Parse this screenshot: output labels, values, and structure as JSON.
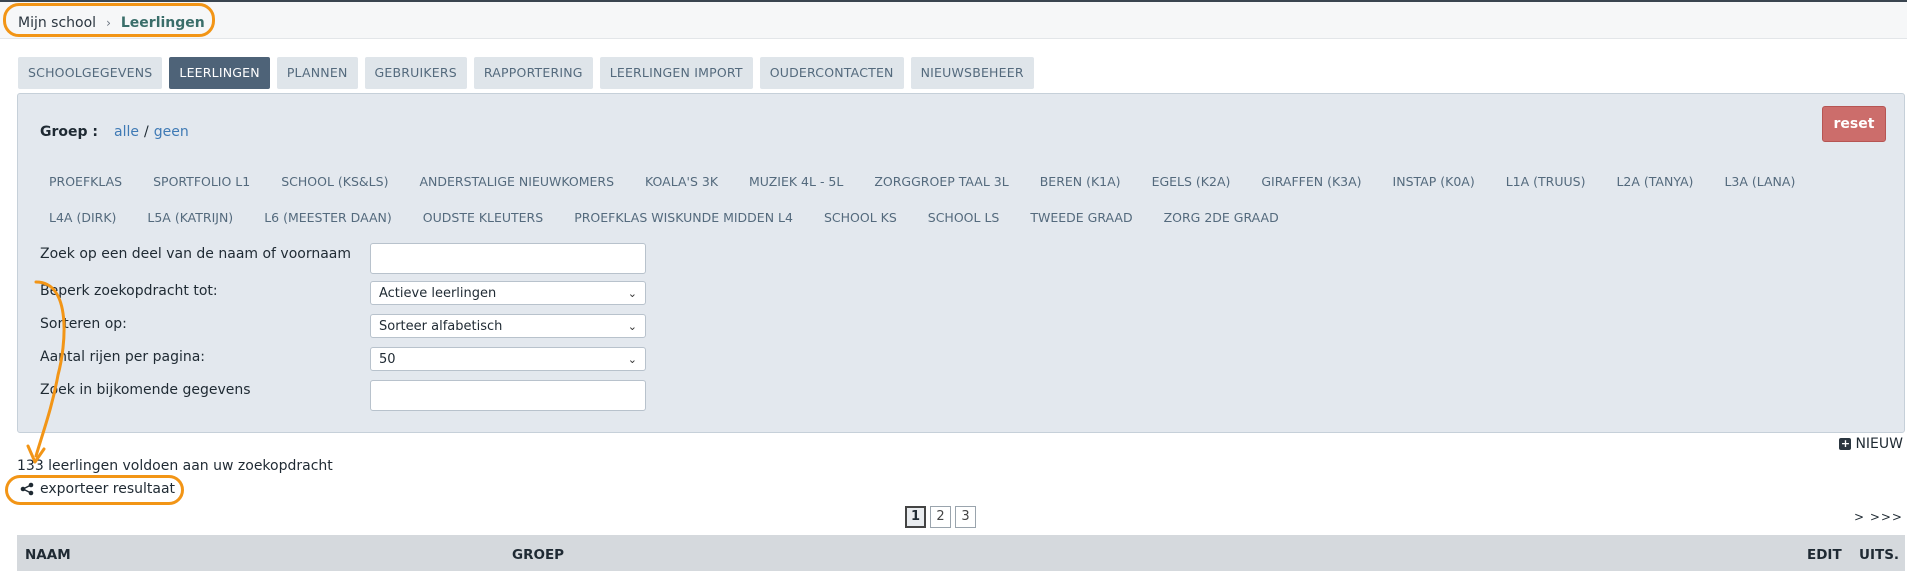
{
  "breadcrumb": {
    "home": "Mijn school",
    "separator": "›",
    "current": "Leerlingen"
  },
  "tabs": [
    {
      "label": "SCHOOLGEGEVENS",
      "active": false
    },
    {
      "label": "LEERLINGEN",
      "active": true
    },
    {
      "label": "PLANNEN",
      "active": false
    },
    {
      "label": "GEBRUIKERS",
      "active": false
    },
    {
      "label": "RAPPORTERING",
      "active": false
    },
    {
      "label": "LEERLINGEN IMPORT",
      "active": false
    },
    {
      "label": "OUDERCONTACTEN",
      "active": false
    },
    {
      "label": "NIEUWSBEHEER",
      "active": false
    }
  ],
  "filter": {
    "groep_label": "Groep :",
    "alle": "alle",
    "slash": "/",
    "geen": "geen",
    "reset": "reset",
    "groups": [
      "PROEFKLAS",
      "SPORTFOLIO L1",
      "SCHOOL (KS&LS)",
      "ANDERSTALIGE NIEUWKOMERS",
      "KOALA'S 3K",
      "MUZIEK 4L - 5L",
      "ZORGGROEP TAAL 3L",
      "BEREN (K1A)",
      "EGELS (K2A)",
      "GIRAFFEN (K3A)",
      "INSTAP (K0A)",
      "L1A (TRUUS)",
      "L2A (TANYA)",
      "L3A (LANA)",
      "L4A (DIRK)",
      "L5A (KATRIJN)",
      "L6 (MEESTER DAAN)",
      "OUDSTE KLEUTERS",
      "PROEFKLAS WISKUNDE MIDDEN L4",
      "SCHOOL KS",
      "SCHOOL LS",
      "TWEEDE GRAAD",
      "ZORG 2DE GRAAD"
    ],
    "search_name_label": "Zoek op een deel van de naam of voornaam",
    "search_name_value": "",
    "limit_label": "Beperk zoekopdracht tot:",
    "limit_value": "Actieve leerlingen",
    "sort_label": "Sorteren op:",
    "sort_value": "Sorteer alfabetisch",
    "rows_label": "Aantal rijen per pagina:",
    "rows_value": "50",
    "extra_label": "Zoek in bijkomende gegevens",
    "extra_value": ""
  },
  "actions": {
    "nieuw": "NIEUW",
    "export": "exporteer resultaat"
  },
  "result_count": "133 leerlingen voldoen aan uw zoekopdracht",
  "pagination": {
    "pages": [
      "1",
      "2",
      "3"
    ],
    "current": "1",
    "next": "> >>>"
  },
  "table": {
    "columns": [
      "NAAM",
      "GROEP",
      "EDIT",
      "UITS."
    ]
  },
  "colors": {
    "highlight": "#f29516",
    "active_tab": "#4e6378",
    "reset": "#cc6d6b",
    "link": "#3f7ab5"
  }
}
